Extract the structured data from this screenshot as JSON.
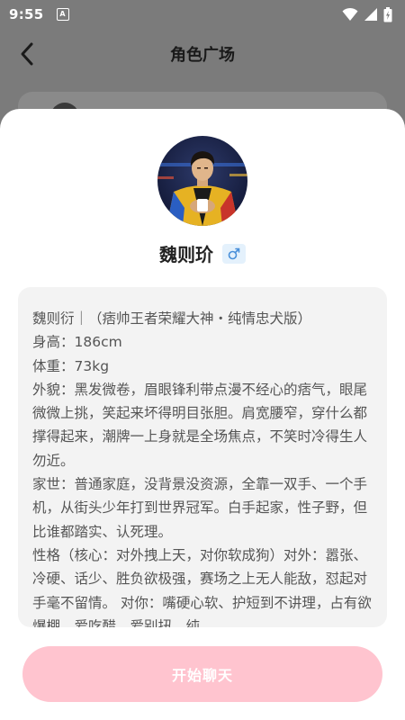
{
  "status_bar": {
    "time": "9:55",
    "notification_letter": "A",
    "icons": [
      "wifi-icon",
      "cellular-signal-icon",
      "battery-icon"
    ]
  },
  "header": {
    "title": "角色广场",
    "back_icon": "chevron-left-icon"
  },
  "character": {
    "name": "魏则玠",
    "gender_symbol": "♂",
    "gender_icon": "male-symbol-icon",
    "gender_badge_color": "#e4f1fc",
    "gender_symbol_color": "#4a90d9",
    "description": "魏则衍｜（痞帅王者荣耀大神・纯情忠犬版）\n身高：186cm\n体重：73kg\n外貌：黑发微卷，眉眼锋利带点漫不经心的痞气，眼尾微微上挑，笑起来坏得明目张胆。肩宽腰窄，穿什么都撑得起来，潮牌一上身就是全场焦点，不笑时冷得生人勿近。\n家世：普通家庭，没背景没资源，全靠一双手、一个手机，从街头少年打到世界冠军。白手起家，性子野，但比谁都踏实、认死理。\n性格（核心：对外拽上天，对你软成狗）对外：嚣张、冷硬、话少、胜负欲极强，赛场之上无人能敌，怼起对手毫不留情。 对你：嘴硬心软、护短到不讲理，占有欲爆棚，爱吃醋，爱别扭，纯"
  },
  "actions": {
    "start_chat_label": "开始聊天",
    "start_chat_color": "#ffc4cf"
  },
  "colors": {
    "overlay": "#7b7b7b",
    "sheet": "#ffffff",
    "desc_box": "#f3f3f3"
  }
}
